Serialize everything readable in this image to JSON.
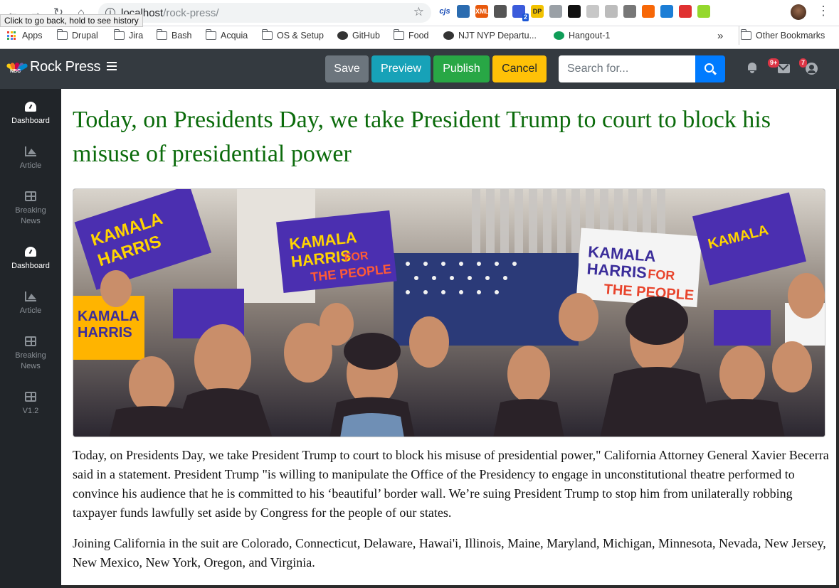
{
  "browser": {
    "tooltip": "Click to go back, hold to see history",
    "url_host": "localhost",
    "url_path": "/rock-press/",
    "extensions": [
      {
        "name": "cjs-extension-icon",
        "label": "cjs",
        "color": "#ffffff"
      },
      {
        "name": "compass-extension-icon",
        "label": "",
        "color": "#2b6cb0"
      },
      {
        "name": "xml-extension-icon",
        "label": "XML",
        "color": "#e8590c"
      },
      {
        "name": "gear-extension-icon",
        "label": "",
        "color": "#555555"
      },
      {
        "name": "chat-extension-icon",
        "label": "",
        "color": "#3b5bdb",
        "badge": "2"
      },
      {
        "name": "dp-extension-icon",
        "label": "DP",
        "color": "#f2c200"
      },
      {
        "name": "grey-extension-icon",
        "label": "",
        "color": "#9aa0a6"
      },
      {
        "name": "search-extension-icon",
        "label": "",
        "color": "#111111"
      },
      {
        "name": "grid-extension-icon",
        "label": "",
        "color": "#c7c7c7"
      },
      {
        "name": "circle-extension-icon",
        "label": "",
        "color": "#bcbcbc"
      },
      {
        "name": "skype-extension-icon",
        "label": "",
        "color": "#777777"
      },
      {
        "name": "orange-extension-icon",
        "label": "",
        "color": "#f76707"
      },
      {
        "name": "flag-extension-icon",
        "label": "",
        "color": "#1c7ed6"
      },
      {
        "name": "nbc-extension-icon",
        "label": "",
        "color": "#e03131"
      },
      {
        "name": "diamond-extension-icon",
        "label": "",
        "color": "#94d82d"
      }
    ]
  },
  "bookmarks": [
    {
      "label": "Apps",
      "icon": "apps-grid-icon"
    },
    {
      "label": "Drupal",
      "icon": "folder-icon"
    },
    {
      "label": "Jira",
      "icon": "folder-icon"
    },
    {
      "label": "Bash",
      "icon": "folder-icon"
    },
    {
      "label": "Acquia",
      "icon": "folder-icon"
    },
    {
      "label": "OS & Setup",
      "icon": "folder-icon"
    },
    {
      "label": "GitHub",
      "icon": "github-icon"
    },
    {
      "label": "Food",
      "icon": "folder-icon"
    },
    {
      "label": "NJT NYP Departu...",
      "icon": "globe-icon"
    },
    {
      "label": "Hangout-1",
      "icon": "hangouts-icon"
    }
  ],
  "bookmarks_overflow": "»",
  "bookmarks_other": "Other Bookmarks",
  "app": {
    "brand": "Rock Press",
    "logo_text": "NBC",
    "buttons": {
      "save": "Save",
      "preview": "Preview",
      "publish": "Publish",
      "cancel": "Cancel"
    },
    "search_placeholder": "Search for...",
    "badges": {
      "messages": "9+",
      "user": "7"
    },
    "colors": {
      "header_bg": "#343a40",
      "sidebar_bg": "#212529",
      "save": "#6c757d",
      "preview": "#17a2b8",
      "publish": "#28a745",
      "cancel": "#ffc107",
      "search_button": "#007bff",
      "badge": "#dc3545",
      "title": "#0b6b0b"
    }
  },
  "sidebar": {
    "items": [
      {
        "label": "Dashboard",
        "icon": "dashboard-gauge-icon",
        "active": true
      },
      {
        "label": "Article",
        "icon": "area-chart-icon",
        "active": false
      },
      {
        "label": "Breaking News",
        "icon": "table-icon",
        "active": false
      },
      {
        "label": "Dashboard",
        "icon": "dashboard-gauge-icon",
        "active": true
      },
      {
        "label": "Article",
        "icon": "area-chart-icon",
        "active": false
      },
      {
        "label": "Breaking News",
        "icon": "table-icon",
        "active": false
      },
      {
        "label": "V1.2",
        "icon": "table-icon",
        "active": false
      }
    ]
  },
  "article": {
    "title": "Today, on Presidents Day, we take President Trump to court to block his misuse of presidential power",
    "image_signs": [
      "KAMALA HARRIS FOR THE PEOPLE"
    ],
    "paragraphs": [
      "Today, on Presidents Day, we take President Trump to court to block his misuse of presidential power,\" California Attorney General Xavier Becerra said in a statement. President Trump \"is willing to manipulate the Office of the Presidency to engage in unconstitutional theatre performed to convince his audience that he is committed to his ‘beautiful’ border wall. We’re suing President Trump to stop him from unilaterally robbing taxpayer funds lawfully set aside by Congress for the people of our states.",
      "Joining California in the suit are Colorado, Connecticut, Delaware, Hawai'i, Illinois, Maine, Maryland, Michigan, Minnesota, Nevada, New Jersey, New Mexico, New York, Oregon, and Virginia."
    ]
  }
}
